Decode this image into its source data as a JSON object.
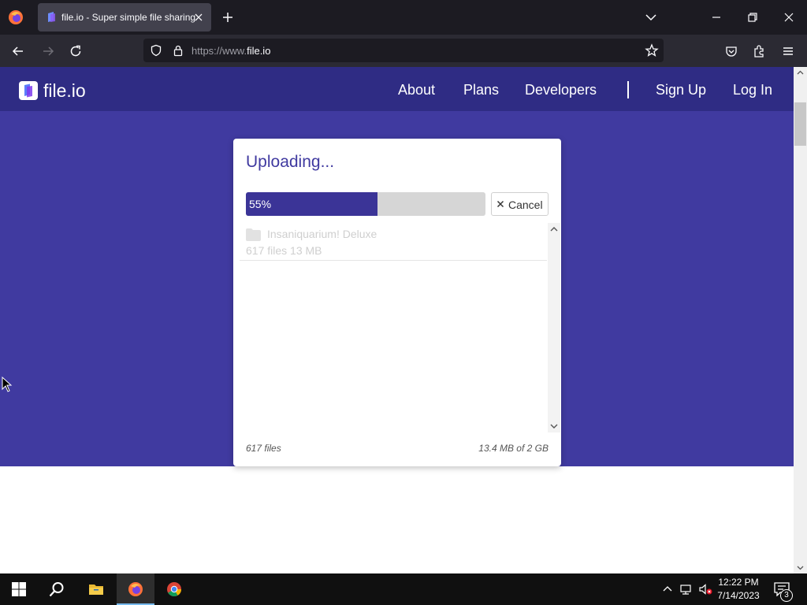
{
  "browser": {
    "tab_title": "file.io - Super simple file sharing",
    "url_prefix": "https://www.",
    "url_domain": "file.io"
  },
  "site": {
    "brand": "file.io",
    "nav": {
      "about": "About",
      "plans": "Plans",
      "developers": "Developers",
      "signup": "Sign Up",
      "login": "Log In"
    }
  },
  "upload": {
    "title": "Uploading...",
    "progress_percent": 55,
    "progress_label": "55%",
    "cancel_label": "Cancel",
    "files": [
      {
        "name": "Insaniquarium! Deluxe",
        "meta": "617 files 13 MB",
        "icon": "folder-icon"
      }
    ],
    "footer_count": "617 files",
    "footer_size": "13.4 MB of 2 GB"
  },
  "taskbar": {
    "time": "12:22 PM",
    "date": "7/14/2023",
    "notification_count": "3",
    "apps": [
      "start-icon",
      "search-icon",
      "file-explorer-icon",
      "firefox-icon",
      "chrome-icon"
    ]
  },
  "colors": {
    "header": "#2f2c84",
    "hero": "#403aa0",
    "progress_fill": "#3b3497",
    "progress_track": "#d6d6d6"
  }
}
